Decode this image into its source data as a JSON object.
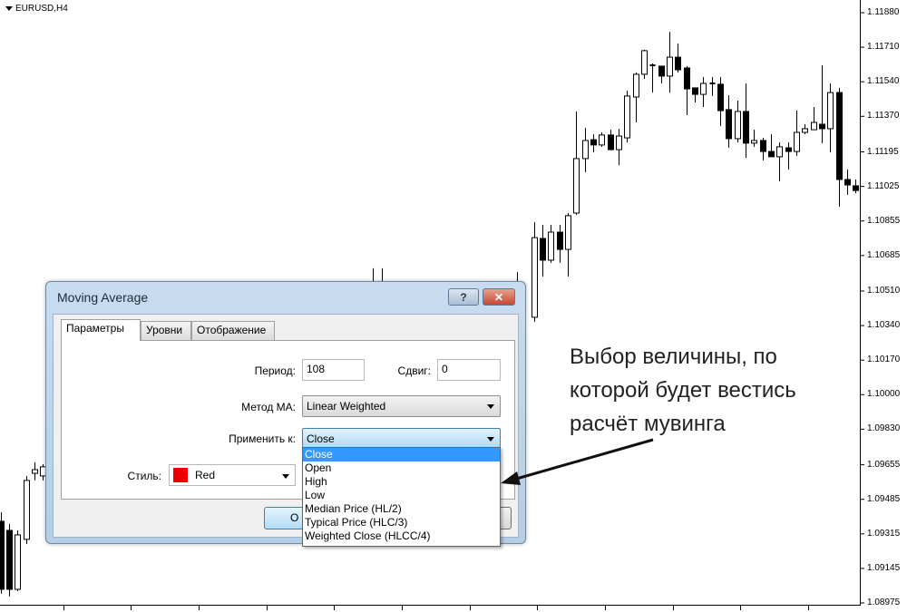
{
  "chart": {
    "symbol_label": "EURUSD,H4",
    "symbol_menu_icon": "triangle-down-icon",
    "bull_color": "#ffffff",
    "bear_color": "#000000",
    "line_color": "#000000"
  },
  "chart_data": {
    "type": "candlestick",
    "title": "EURUSD,H4",
    "ylim": [
      1.08975,
      1.1188
    ],
    "y_ticks": [
      "1.11880",
      "1.11710",
      "1.11540",
      "1.11370",
      "1.11195",
      "1.11025",
      "1.10855",
      "1.10685",
      "1.10510",
      "1.10340",
      "1.10170",
      "1.10000",
      "1.09830",
      "1.09655",
      "1.09485",
      "1.09315",
      "1.09145",
      "1.08975"
    ],
    "bar_index_range": [
      -1,
      101
    ],
    "x_tick_every_bars": 8,
    "grid": false,
    "candles_ohlc": [
      [
        -1,
        1.09377,
        1.09421,
        1.0902,
        1.09042
      ],
      [
        0,
        1.09332,
        1.09363,
        1.09007,
        1.09042
      ],
      [
        1,
        1.09042,
        1.09332,
        1.09033,
        1.0931
      ],
      [
        2,
        1.09288,
        1.096,
        1.09265,
        1.09578
      ],
      [
        3,
        1.09613,
        1.09667,
        1.09578,
        1.09631
      ],
      [
        4,
        1.096,
        1.09658,
        1.09578,
        1.09645
      ],
      [
        43,
        1.1047,
        1.10622,
        1.10381,
        1.10425
      ],
      [
        44,
        1.10425,
        1.10622,
        1.10381,
        1.1047
      ],
      [
        60,
        1.10425,
        1.10604,
        1.10359,
        1.1047
      ],
      [
        62,
        1.10381,
        1.10849,
        1.10359,
        1.10773
      ],
      [
        63,
        1.10769,
        1.10836,
        1.10582,
        1.10662
      ],
      [
        64,
        1.10662,
        1.10836,
        1.10649,
        1.108
      ],
      [
        65,
        1.108,
        1.10836,
        1.10649,
        1.10715
      ],
      [
        66,
        1.10715,
        1.10894,
        1.10582,
        1.10881
      ],
      [
        67,
        1.10894,
        1.11394,
        1.10885,
        1.11162
      ],
      [
        68,
        1.11162,
        1.11313,
        1.11095,
        1.11251
      ],
      [
        69,
        1.11255,
        1.11282,
        1.11193,
        1.11229
      ],
      [
        70,
        1.11229,
        1.11291,
        1.1122,
        1.11278
      ],
      [
        71,
        1.11278,
        1.11304,
        1.11202,
        1.11206
      ],
      [
        72,
        1.11206,
        1.11309,
        1.1113,
        1.11273
      ],
      [
        73,
        1.11264,
        1.11496,
        1.11242,
        1.1147
      ],
      [
        74,
        1.11465,
        1.11586,
        1.1134,
        1.11577
      ],
      [
        75,
        1.11577,
        1.11697,
        1.11554,
        1.11693
      ],
      [
        76,
        1.11617,
        1.1163,
        1.11487,
        1.11621
      ],
      [
        77,
        1.11617,
        1.11617,
        1.11532,
        1.11568
      ],
      [
        78,
        1.11568,
        1.11786,
        1.11487,
        1.11661
      ],
      [
        79,
        1.11661,
        1.11728,
        1.11586,
        1.11599
      ],
      [
        80,
        1.11608,
        1.11617,
        1.11376,
        1.11505
      ],
      [
        81,
        1.1151,
        1.1151,
        1.11438,
        1.11478
      ],
      [
        82,
        1.11478,
        1.11563,
        1.11416,
        1.11532
      ],
      [
        83,
        1.11528,
        1.11563,
        1.1147,
        1.11532
      ],
      [
        84,
        1.11528,
        1.11563,
        1.11322,
        1.11398
      ],
      [
        85,
        1.11403,
        1.11474,
        1.11215,
        1.1126
      ],
      [
        86,
        1.1126,
        1.11447,
        1.11242,
        1.11394
      ],
      [
        87,
        1.11394,
        1.11532,
        1.11166,
        1.11238
      ],
      [
        88,
        1.11238,
        1.11304,
        1.1122,
        1.11251
      ],
      [
        89,
        1.11251,
        1.11264,
        1.11153,
        1.11197
      ],
      [
        90,
        1.11197,
        1.11282,
        1.11171,
        1.11171
      ],
      [
        91,
        1.11171,
        1.11242,
        1.1105,
        1.1122
      ],
      [
        92,
        1.11215,
        1.11242,
        1.11108,
        1.11197
      ],
      [
        93,
        1.11197,
        1.11398,
        1.11175,
        1.11291
      ],
      [
        94,
        1.11291,
        1.11331,
        1.11282,
        1.11309
      ],
      [
        95,
        1.11304,
        1.11416,
        1.11304,
        1.1134
      ],
      [
        96,
        1.11331,
        1.11621,
        1.11238,
        1.11309
      ],
      [
        97,
        1.11309,
        1.11532,
        1.11193,
        1.11487
      ],
      [
        98,
        1.11487,
        1.1151,
        1.10925,
        1.11059
      ],
      [
        99,
        1.11059,
        1.11108,
        1.10983,
        1.11032
      ],
      [
        100,
        1.11028,
        1.11059,
        1.10992,
        1.11005
      ]
    ]
  },
  "dialog": {
    "title": "Moving Average",
    "help_label": "?",
    "close_label": "✕",
    "tabs": [
      {
        "label": "Параметры",
        "active": true
      },
      {
        "label": "Уровни"
      },
      {
        "label": "Отображение"
      }
    ],
    "period_label": "Период:",
    "period_value": "108",
    "shift_label": "Сдвиг:",
    "shift_value": "0",
    "method_label": "Метод МА:",
    "method_value": "Linear Weighted",
    "apply_label": "Применить к:",
    "apply_value": "Close",
    "style_label": "Стиль:",
    "style_color_name": "Red",
    "style_color": "#ee0000",
    "ok_label": "O",
    "apply_options": [
      "Close",
      "Open",
      "High",
      "Low",
      "Median Price (HL/2)",
      "Typical Price (HLC/3)",
      "Weighted Close (HLCC/4)"
    ],
    "highlighted_option": "Close"
  },
  "annotation": {
    "lines": [
      "Выбор величины, по",
      "которой будет вестись",
      "расчёт мувинга"
    ],
    "arrow_icon": "arrow-left-icon"
  }
}
